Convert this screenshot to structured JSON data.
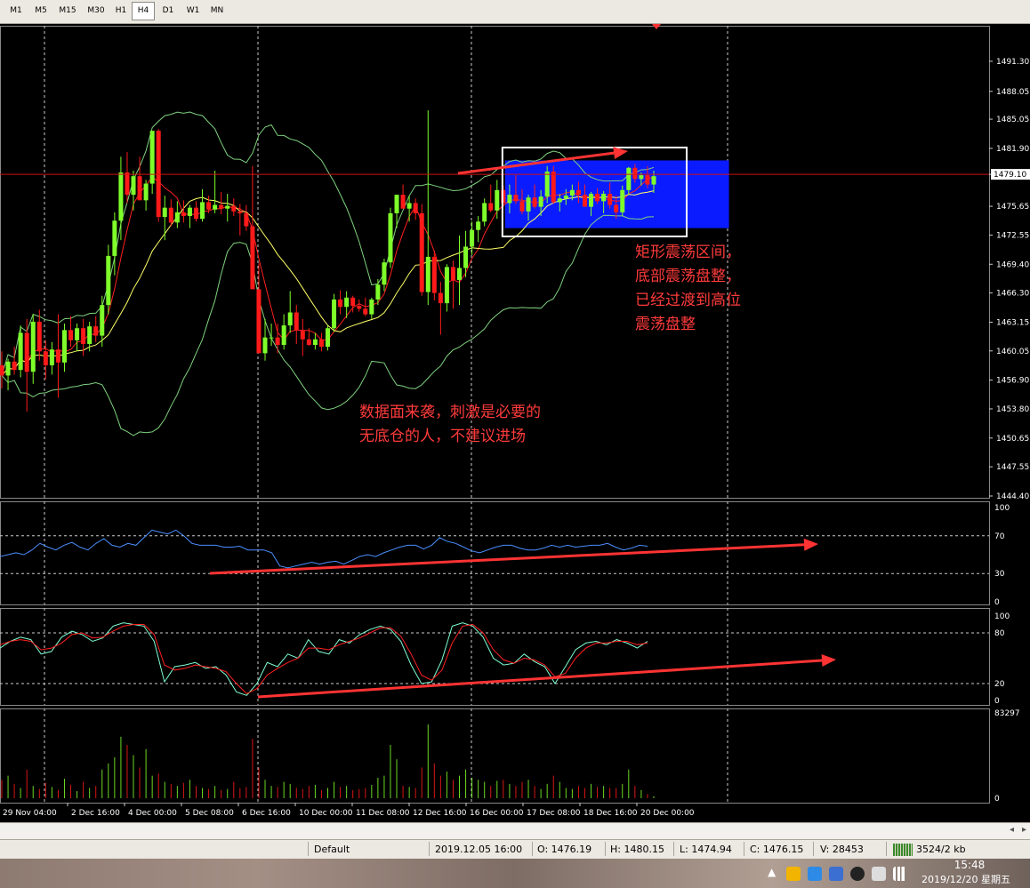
{
  "toolbar": {
    "timeframes": [
      "M1",
      "M5",
      "M15",
      "M30",
      "H1",
      "H4",
      "D1",
      "W1",
      "MN"
    ],
    "active": "H4"
  },
  "colors": {
    "background": "#000000",
    "bull_candle": "#7fff2a",
    "bear_candle": "#ff1a1a",
    "bollinger": "#7fd27f",
    "ma_red": "#ff2020",
    "ma_yellow": "#ffff66",
    "rsi_line": "#4a8fff",
    "stoch_main": "#7fffd4",
    "stoch_signal": "#ff2020",
    "annotation": "#ff3b3b",
    "box": "#ffffff",
    "box_fill": "#0a1cff"
  },
  "chart_data": [
    {
      "type": "candlestick",
      "symbol_panel": "price",
      "ylim": [
        1444.4,
        1494.55
      ],
      "y_ticks": [
        "1491.30",
        "1488.05",
        "1485.05",
        "1481.90",
        "1479.10",
        "1475.65",
        "1472.55",
        "1469.40",
        "1466.30",
        "1463.15",
        "1460.05",
        "1456.90",
        "1453.80",
        "1450.65",
        "1447.55",
        "1444.40"
      ],
      "current_price": "1479.10",
      "x_labels": [
        "29 Nov 04:00",
        "2 Dec 16:00",
        "4 Dec 00:00",
        "5 Dec 08:00",
        "6 Dec 16:00",
        "10 Dec 00:00",
        "11 Dec 08:00",
        "12 Dec 16:00",
        "16 Dec 00:00",
        "17 Dec 08:00",
        "18 Dec 16:00",
        "20 Dec 00:00"
      ],
      "candles": [
        [
          1458.5,
          1460.0,
          1456.0,
          1457.4
        ],
        [
          1457.4,
          1459.2,
          1455.8,
          1458.9
        ],
        [
          1458.9,
          1460.5,
          1457.5,
          1458.0
        ],
        [
          1458.0,
          1462.8,
          1457.2,
          1462.0
        ],
        [
          1462.0,
          1463.5,
          1453.5,
          1457.8
        ],
        [
          1457.8,
          1464.0,
          1456.5,
          1463.2
        ],
        [
          1463.2,
          1464.5,
          1459.0,
          1460.0
        ],
        [
          1460.0,
          1461.2,
          1457.0,
          1458.5
        ],
        [
          1458.5,
          1461.0,
          1457.5,
          1460.2
        ],
        [
          1460.2,
          1464.0,
          1455.0,
          1458.8
        ],
        [
          1458.8,
          1463.0,
          1457.8,
          1462.3
        ],
        [
          1462.3,
          1463.8,
          1460.5,
          1461.2
        ],
        [
          1461.2,
          1463.0,
          1460.0,
          1462.5
        ],
        [
          1462.5,
          1463.5,
          1459.5,
          1460.8
        ],
        [
          1460.8,
          1463.2,
          1460.0,
          1462.7
        ],
        [
          1462.7,
          1463.8,
          1461.0,
          1461.7
        ],
        [
          1461.7,
          1466.0,
          1460.5,
          1465.0
        ],
        [
          1465.0,
          1471.5,
          1464.0,
          1470.3
        ],
        [
          1470.3,
          1475.0,
          1468.2,
          1474.1
        ],
        [
          1474.1,
          1481.0,
          1472.0,
          1479.3
        ],
        [
          1479.3,
          1481.5,
          1476.0,
          1476.9
        ],
        [
          1476.9,
          1479.5,
          1475.2,
          1478.9
        ],
        [
          1478.9,
          1481.0,
          1476.4,
          1476.3
        ],
        [
          1476.3,
          1478.5,
          1475.2,
          1478.1
        ],
        [
          1478.1,
          1483.8,
          1477.0,
          1483.8
        ],
        [
          1483.8,
          1484.0,
          1474.0,
          1474.5
        ],
        [
          1474.5,
          1476.8,
          1472.0,
          1475.5
        ],
        [
          1475.5,
          1476.4,
          1473.5,
          1473.9
        ],
        [
          1473.9,
          1476.2,
          1473.3,
          1475.0
        ],
        [
          1475.0,
          1476.3,
          1473.9,
          1474.6
        ],
        [
          1474.6,
          1475.8,
          1473.3,
          1475.5
        ],
        [
          1475.5,
          1476.2,
          1474.0,
          1474.3
        ],
        [
          1474.3,
          1477.5,
          1474.0,
          1476.1
        ],
        [
          1476.1,
          1476.8,
          1474.9,
          1475.3
        ],
        [
          1475.3,
          1479.5,
          1474.9,
          1475.8
        ],
        [
          1475.8,
          1477.2,
          1474.8,
          1475.4
        ],
        [
          1475.4,
          1477.0,
          1474.0,
          1475.7
        ],
        [
          1475.7,
          1476.5,
          1474.6,
          1475.1
        ],
        [
          1475.1,
          1475.9,
          1472.5,
          1474.9
        ],
        [
          1474.9,
          1475.8,
          1473.0,
          1473.5
        ],
        [
          1473.5,
          1480.0,
          1468.0,
          1466.7
        ],
        [
          1466.7,
          1469.5,
          1460.0,
          1459.8
        ],
        [
          1459.8,
          1463.5,
          1459.0,
          1461.5
        ],
        [
          1461.5,
          1463.0,
          1460.6,
          1461.5
        ],
        [
          1461.5,
          1463.0,
          1459.8,
          1460.7
        ],
        [
          1460.7,
          1464.0,
          1460.2,
          1462.8
        ],
        [
          1462.8,
          1466.5,
          1462.0,
          1464.2
        ],
        [
          1464.2,
          1465.0,
          1460.8,
          1462.3
        ],
        [
          1462.3,
          1463.5,
          1459.5,
          1461.3
        ],
        [
          1461.3,
          1462.5,
          1460.6,
          1460.7
        ],
        [
          1460.7,
          1462.0,
          1460.2,
          1461.3
        ],
        [
          1461.3,
          1462.0,
          1460.0,
          1460.5
        ],
        [
          1460.5,
          1462.8,
          1460.1,
          1462.5
        ],
        [
          1462.5,
          1466.2,
          1462.1,
          1465.6
        ],
        [
          1465.6,
          1466.6,
          1464.0,
          1464.8
        ],
        [
          1464.8,
          1466.5,
          1463.6,
          1465.8
        ],
        [
          1465.8,
          1466.0,
          1464.2,
          1464.9
        ],
        [
          1464.9,
          1465.6,
          1464.3,
          1464.6
        ],
        [
          1464.6,
          1465.8,
          1463.8,
          1464.0
        ],
        [
          1464.0,
          1465.8,
          1463.5,
          1465.6
        ],
        [
          1465.6,
          1467.8,
          1465.0,
          1467.2
        ],
        [
          1467.2,
          1470.0,
          1466.5,
          1469.6
        ],
        [
          1469.6,
          1475.5,
          1469.0,
          1474.9
        ],
        [
          1474.9,
          1476.9,
          1473.3,
          1476.9
        ],
        [
          1476.9,
          1478.0,
          1476.0,
          1475.4
        ],
        [
          1475.4,
          1476.8,
          1474.0,
          1476.0
        ],
        [
          1476.0,
          1476.5,
          1474.2,
          1474.9
        ],
        [
          1474.9,
          1475.9,
          1466.0,
          1466.4
        ],
        [
          1466.4,
          1486.0,
          1465.0,
          1470.2
        ],
        [
          1470.2,
          1470.9,
          1465.5,
          1466.3
        ],
        [
          1466.3,
          1467.5,
          1461.8,
          1465.2
        ],
        [
          1465.2,
          1469.4,
          1464.3,
          1469.1
        ],
        [
          1469.1,
          1469.8,
          1464.6,
          1467.7
        ],
        [
          1467.7,
          1472.5,
          1465.0,
          1469.0
        ],
        [
          1469.0,
          1473.0,
          1468.0,
          1471.3
        ],
        [
          1471.3,
          1474.0,
          1470.4,
          1473.1
        ],
        [
          1473.1,
          1474.6,
          1471.8,
          1474.0
        ],
        [
          1474.0,
          1476.5,
          1473.5,
          1476.0
        ],
        [
          1476.0,
          1478.0,
          1475.0,
          1475.2
        ],
        [
          1475.2,
          1478.5,
          1474.3,
          1477.4
        ],
        [
          1477.4,
          1477.9,
          1475.6,
          1476.0
        ],
        [
          1476.0,
          1478.0,
          1474.9,
          1476.9
        ],
        [
          1476.9,
          1479.0,
          1475.9,
          1476.2
        ],
        [
          1476.2,
          1477.5,
          1474.8,
          1475.1
        ],
        [
          1475.1,
          1476.9,
          1474.1,
          1476.6
        ],
        [
          1476.6,
          1478.0,
          1475.4,
          1475.6
        ],
        [
          1475.6,
          1477.4,
          1474.6,
          1476.7
        ],
        [
          1476.7,
          1480.0,
          1476.0,
          1479.4
        ],
        [
          1479.4,
          1480.0,
          1475.9,
          1476.1
        ],
        [
          1476.1,
          1477.0,
          1475.1,
          1476.5
        ],
        [
          1476.5,
          1477.5,
          1475.8,
          1476.8
        ],
        [
          1476.8,
          1478.0,
          1476.3,
          1477.4
        ],
        [
          1477.4,
          1478.3,
          1476.0,
          1476.9
        ],
        [
          1476.9,
          1478.0,
          1476.2,
          1475.6
        ],
        [
          1475.6,
          1477.2,
          1474.6,
          1477.0
        ],
        [
          1477.0,
          1477.6,
          1475.9,
          1476.2
        ],
        [
          1476.2,
          1477.3,
          1474.9,
          1477.0
        ],
        [
          1477.0,
          1478.2,
          1475.4,
          1475.8
        ],
        [
          1475.8,
          1476.8,
          1474.3,
          1475.0
        ],
        [
          1475.0,
          1477.9,
          1474.6,
          1477.4
        ],
        [
          1477.4,
          1479.9,
          1476.9,
          1479.8
        ],
        [
          1479.8,
          1480.2,
          1478.2,
          1478.6
        ],
        [
          1478.6,
          1479.3,
          1477.9,
          1479.0
        ],
        [
          1479.0,
          1480.0,
          1477.6,
          1478.0
        ],
        [
          1478.0,
          1479.5,
          1477.1,
          1478.9
        ]
      ],
      "annotation_box": {
        "from_candle": 80,
        "to_candle": 116,
        "ylim": [
          1473.0,
          1481.8
        ]
      }
    },
    {
      "type": "line",
      "name": "rsi",
      "ylim": [
        0,
        100
      ],
      "y_ticks": [
        "100",
        "70",
        "30",
        "0"
      ],
      "levels": [
        70,
        30
      ],
      "values": [
        48,
        50,
        52,
        50,
        55,
        62,
        58,
        55,
        60,
        63,
        58,
        55,
        62,
        67,
        60,
        58,
        62,
        60,
        68,
        76,
        74,
        72,
        76,
        70,
        62,
        60,
        60,
        60,
        58,
        58,
        59,
        55,
        55,
        55,
        52,
        38,
        36,
        38,
        40,
        42,
        40,
        42,
        43,
        40,
        44,
        48,
        50,
        48,
        52,
        55,
        58,
        60,
        60,
        56,
        60,
        68,
        64,
        62,
        58,
        54,
        52,
        55,
        58,
        60,
        60,
        57,
        55,
        55,
        57,
        60,
        58,
        60,
        58,
        59,
        60,
        60,
        62,
        58,
        55,
        57,
        60,
        59
      ]
    },
    {
      "type": "line",
      "name": "stochastic",
      "ylim": [
        0,
        100
      ],
      "y_ticks": [
        "100",
        "80",
        "20",
        "0"
      ],
      "levels": [
        80,
        20
      ],
      "series": [
        {
          "values": [
            62,
            70,
            75,
            72,
            55,
            58,
            75,
            82,
            78,
            70,
            74,
            88,
            92,
            90,
            88,
            70,
            22,
            40,
            42,
            45,
            38,
            40,
            30,
            10,
            6,
            20,
            45,
            40,
            55,
            50,
            72,
            58,
            55,
            72,
            68,
            78,
            84,
            88,
            84,
            70,
            42,
            20,
            22,
            48,
            88,
            92,
            88,
            75,
            50,
            42,
            44,
            55,
            46,
            40,
            20,
            40,
            60,
            68,
            70,
            66,
            72,
            68,
            62,
            70
          ]
        },
        {
          "values": [
            66,
            70,
            72,
            70,
            60,
            62,
            68,
            78,
            80,
            74,
            75,
            82,
            88,
            90,
            90,
            78,
            42,
            36,
            38,
            42,
            40,
            38,
            34,
            20,
            8,
            14,
            30,
            38,
            45,
            50,
            62,
            62,
            60,
            66,
            70,
            74,
            80,
            86,
            86,
            76,
            55,
            30,
            24,
            36,
            68,
            88,
            90,
            80,
            60,
            48,
            44,
            50,
            48,
            42,
            28,
            32,
            50,
            62,
            68,
            68,
            70,
            70,
            66,
            68
          ]
        }
      ]
    },
    {
      "type": "bar",
      "name": "volume",
      "ylim": [
        0,
        83297
      ],
      "y_ticks": [
        "83297",
        "0"
      ],
      "values": [
        18000,
        22000,
        14000,
        10000,
        28000,
        12000,
        9000,
        15000,
        11000,
        8000,
        19000,
        13000,
        7000,
        16000,
        10000,
        12000,
        28000,
        34000,
        40000,
        60000,
        52000,
        42000,
        30000,
        48000,
        22000,
        24000,
        16000,
        14000,
        12000,
        15000,
        18000,
        12000,
        10000,
        9000,
        12000,
        8000,
        9000,
        16000,
        10000,
        11000,
        58000,
        30000,
        18000,
        12000,
        11000,
        16000,
        14000,
        10000,
        9000,
        12000,
        13000,
        8000,
        10000,
        16000,
        11000,
        12000,
        8000,
        9000,
        10000,
        13000,
        20000,
        22000,
        52000,
        38000,
        12000,
        11000,
        10000,
        30000,
        72000,
        34000,
        22000,
        26000,
        18000,
        22000,
        28000,
        20000,
        18000,
        16000,
        12000,
        17000,
        18000,
        14000,
        12000,
        16000,
        18000,
        12000,
        9000,
        14000,
        22000,
        16000,
        10000,
        9000,
        12000,
        10000,
        14000,
        11000,
        12000,
        10000,
        10000,
        14000,
        28000,
        12000,
        8000,
        4000,
        2000
      ]
    }
  ],
  "annotations": {
    "range_text": [
      "矩形震荡区间，",
      "底部震荡盘整，",
      "已经过渡到高位",
      "震荡盘整"
    ],
    "warning_text": [
      "数据面来袭，刺激是必要的",
      "无底仓的人，不建议进场"
    ]
  },
  "statusbar": {
    "profile": "Default",
    "time": "2019.12.05 16:00",
    "open": "O: 1476.19",
    "high": "H: 1480.15",
    "low": "L: 1474.94",
    "close": "C: 1476.15",
    "volume": "V: 28453",
    "traffic": "3524/2 kb"
  },
  "taskbar": {
    "clock_time": "15:48",
    "clock_date": "2019/12/20 星期五"
  }
}
